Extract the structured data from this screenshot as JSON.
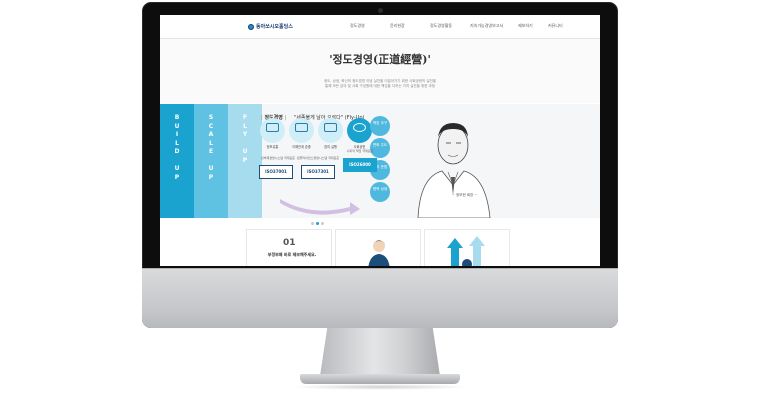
{
  "site": {
    "logo_text": "동아쏘시오홀딩스",
    "menu": [
      "정도경영",
      "윤리헌장",
      "정도경영활동",
      "지속가능경영보고서",
      "제보하기",
      "커뮤니티"
    ]
  },
  "hero": {
    "title": "'정도경영(正道經營)'",
    "description_lines": [
      "정도, 상생, 혁신의 정도경영 이념 실천을 이끌어가기 위한 사회공헌의 실천을",
      "통해 모든 분야 및 사회 구성원에 대한 책임을 다하는 가치 실천을 위한 과정"
    ]
  },
  "stripes": [
    "BUILD UP",
    "SCALE UP",
    "FLY UP"
  ],
  "section": {
    "label": "정도경영",
    "slogan": "\"세종불게 날아 오르다\" (Fly-Up)"
  },
  "circles": [
    {
      "label": "정보유통",
      "icon": "people-icon"
    },
    {
      "label": "이해관계 존중",
      "icon": "people-group-icon"
    },
    {
      "label": "참여 실행",
      "icon": "briefcase-icon"
    },
    {
      "label": "사회공헌",
      "icon": "handshake-icon"
    }
  ],
  "values": [
    "책임 추구",
    "변화 주도",
    "정직 준법",
    "협력 상생"
  ],
  "iso": [
    {
      "note": "반부패경영시스템 국제표준",
      "code": "ISO37001"
    },
    {
      "note": "컴플라이언스경영시스템 국제표준",
      "code": "ISO37301"
    },
    {
      "note": "사회적 책임 국제표준",
      "code": "ISO26000"
    }
  ],
  "ceo_caption": "~ 정보현 회장 ~",
  "cards": {
    "card1_number": "01",
    "card1_text": "부정부패 바로 제보해주세요."
  },
  "colors": {
    "accent": "#1aa3cf",
    "stripe2": "#5fc2e2",
    "stripe3": "#a6dced",
    "navy": "#1b4e7a"
  }
}
